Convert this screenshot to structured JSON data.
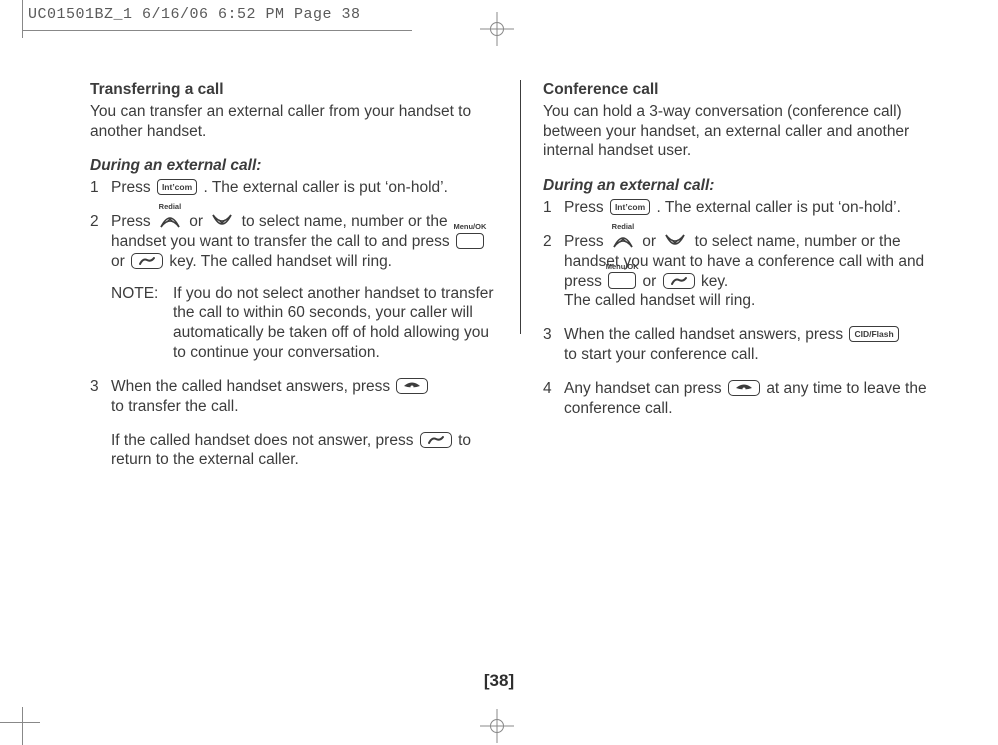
{
  "crop_header": "UC01501BZ_1  6/16/06  6:52 PM  Page 38",
  "page_number": "[38]",
  "left": {
    "title": "Transferring a call",
    "intro": "You can transfer an external caller from your handset to another handset.",
    "subhead": "During an external call:",
    "step1_a": "Press",
    "step1_b": ". The external caller is put ‘on-hold’.",
    "step2_a": "Press",
    "step2_b": "or",
    "step2_c": "to select name, number or the handset you want to transfer the call to and press",
    "step2_d": "or",
    "step2_e": "key. The called handset will ring.",
    "note_label": "NOTE:",
    "note_body": "If you do not select another handset to transfer the call to within 60 seconds, your caller will automatically be taken off of hold allowing you to continue your conversation.",
    "step3_a": "When the called handset answers, press",
    "step3_b": "to transfer the call.",
    "step3_c": "If the called handset does not answer, press",
    "step3_d": "to return to the external caller."
  },
  "right": {
    "title": "Conference call",
    "intro": "You can hold a 3-way conversation (conference call) between your handset, an external caller and another internal handset user.",
    "subhead": "During an external call:",
    "step1_a": "Press",
    "step1_b": ". The external caller is put ‘on-hold’.",
    "step2_a": "Press",
    "step2_b": "or",
    "step2_c": "to select name, number or the handset you want to have a conference call with and press",
    "step2_d": "or",
    "step2_e": "key.",
    "step2_f": "The called handset will ring.",
    "step3_a": "When the called handset answers, press",
    "step3_b": "to start your conference call.",
    "step4_a": "Any handset can press",
    "step4_b": "at any time to leave the conference call."
  },
  "keys": {
    "intcom": "Int’com",
    "redial": "Redial",
    "menuok": "Menu/OK",
    "cidflash": "CID/Flash"
  }
}
